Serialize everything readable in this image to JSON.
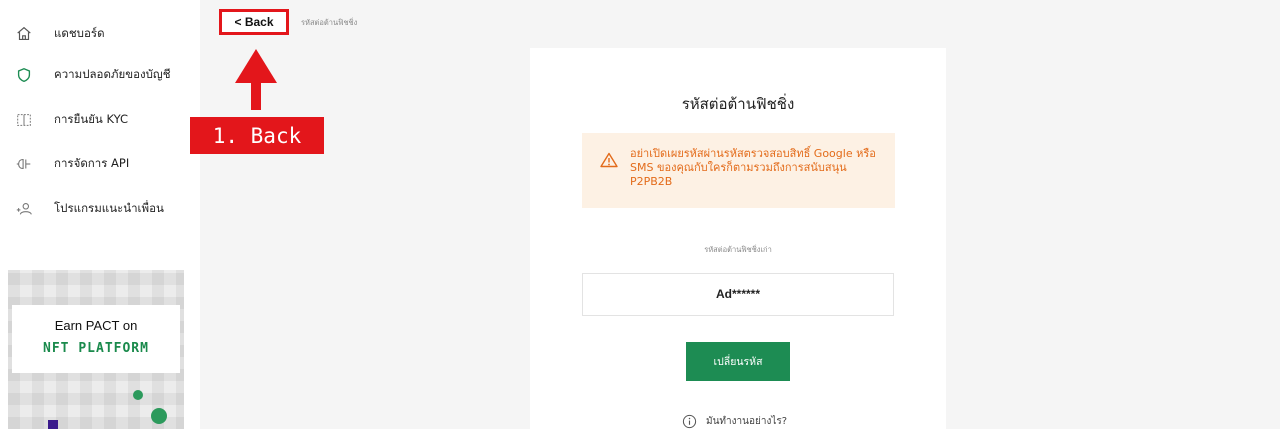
{
  "sidebar": {
    "items": [
      {
        "label": "แดชบอร์ด",
        "icon": "home-icon"
      },
      {
        "label": "ความปลอดภัยของบัญชี",
        "icon": "shield-icon"
      },
      {
        "label": "การยืนยัน KYC",
        "icon": "id-card-icon"
      },
      {
        "label": "การจัดการ API",
        "icon": "api-plug-icon"
      },
      {
        "label": "โปรแกรมแนะนำเพื่อน",
        "icon": "add-user-icon"
      }
    ],
    "active_color": "#1d8c53"
  },
  "promo": {
    "title": "Earn PACT on",
    "subtitle": "NFT PLATFORM"
  },
  "breadcrumb": {
    "back_label": "< Back",
    "current": "รหัสต่อต้านฟิชชิ่ง"
  },
  "annotation": {
    "callout_text": "1. Back",
    "color": "#e3161b"
  },
  "card": {
    "title": "รหัสต่อต้านฟิชชิ่ง",
    "warning": {
      "icon": "warning-triangle-icon",
      "text": "อย่าเปิดเผยรหัสผ่านรหัสตรวจสอบสิทธิ์ Google หรือ SMS ของคุณกับใครก็ตามรวมถึงการสนับสนุน P2PB2B",
      "color": "#e36b1a",
      "background": "#fdf1e4"
    },
    "field_label": "รหัสต่อต้านฟิชชิ่งเก่า",
    "field_value": "Ad******",
    "submit_label": "เปลี่ยนรหัส",
    "help_label": "มันทำงานอย่างไร?",
    "accent": "#1d8c53"
  }
}
